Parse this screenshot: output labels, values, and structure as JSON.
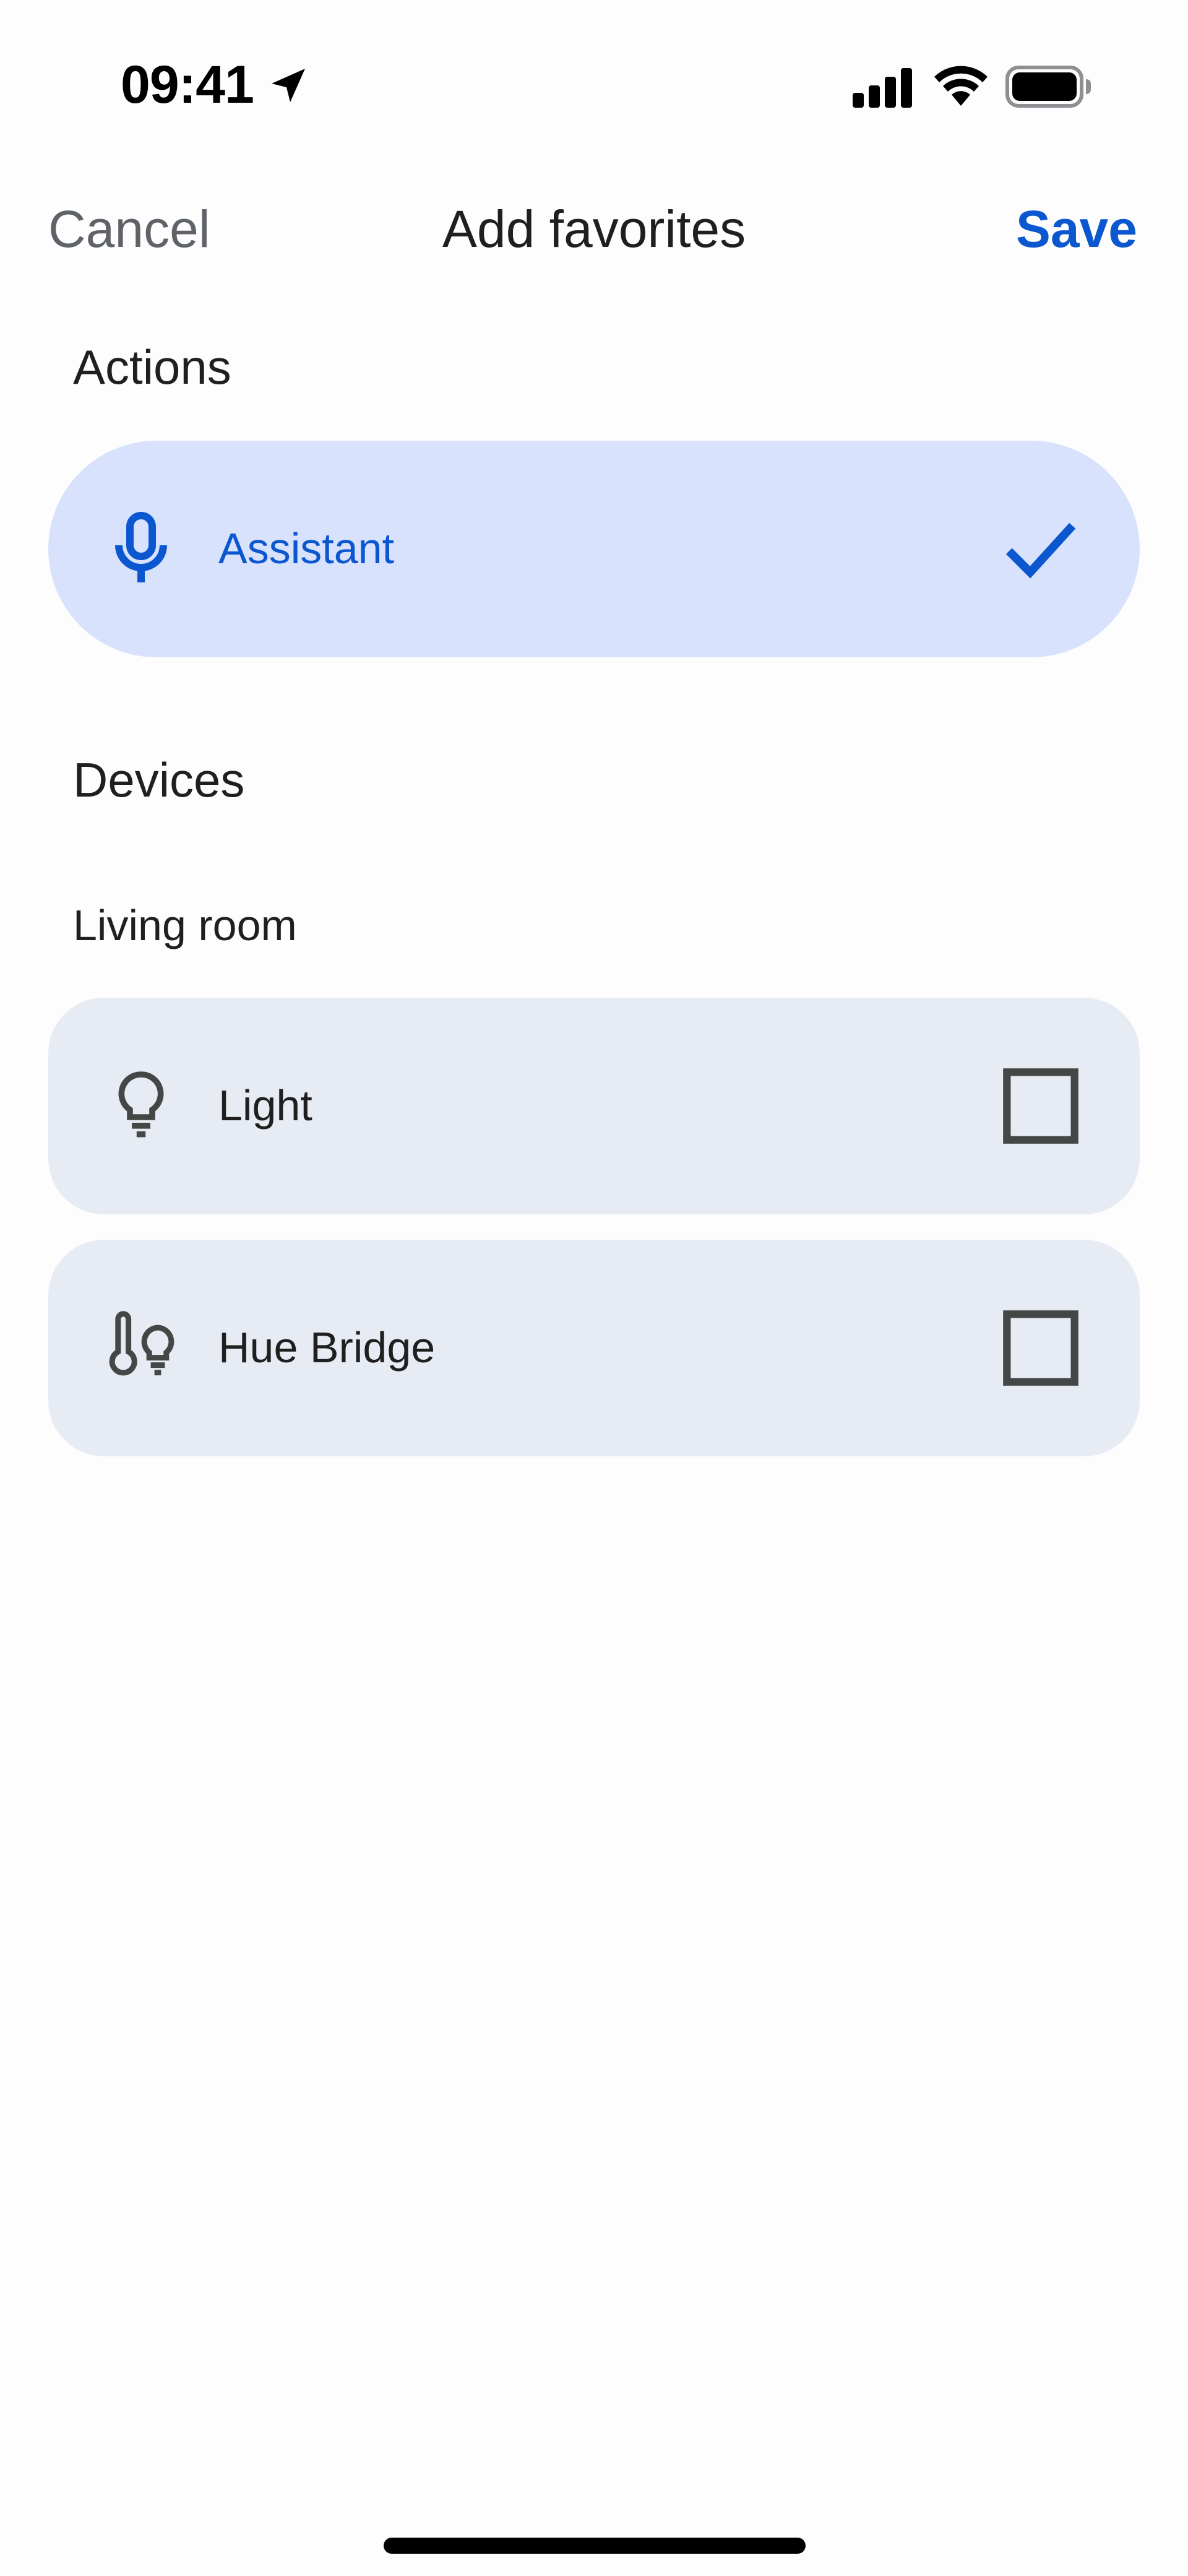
{
  "status_bar": {
    "time": "09:41",
    "icons": [
      "location-arrow-icon",
      "cellular-signal-icon",
      "wifi-icon",
      "battery-icon"
    ]
  },
  "header": {
    "cancel_label": "Cancel",
    "title": "Add favorites",
    "save_label": "Save"
  },
  "actions": {
    "heading": "Actions",
    "items": [
      {
        "label": "Assistant",
        "icon": "microphone-icon",
        "selected": true
      }
    ]
  },
  "devices": {
    "heading": "Devices",
    "rooms": [
      {
        "name": "Living room",
        "items": [
          {
            "label": "Light",
            "icon": "lightbulb-icon",
            "selected": false
          },
          {
            "label": "Hue Bridge",
            "icon": "thermometer-bulb-icon",
            "selected": false
          }
        ]
      }
    ]
  },
  "colors": {
    "accent": "#0b57d0",
    "selected_row_bg": "#d8e2fc",
    "row_bg": "#e7ebf3",
    "muted_text": "#5f6368"
  }
}
